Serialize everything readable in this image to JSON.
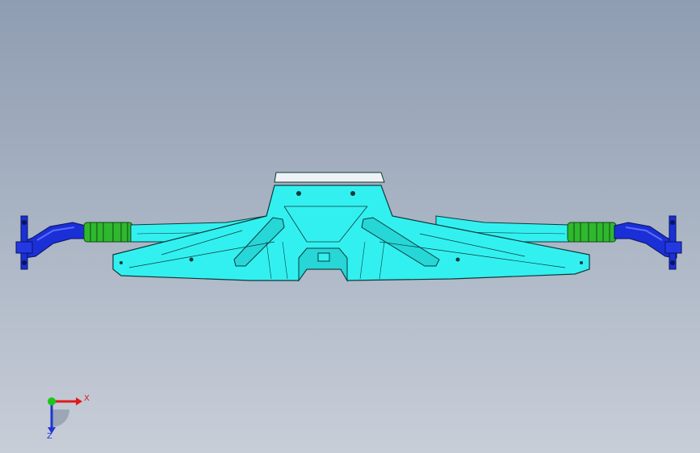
{
  "viewport": {
    "model_color": "#33f0f0",
    "edge_color": "#0d3a3a",
    "link_color": "#1a2fd6",
    "bushing_color": "#2fb82f",
    "top_plate_color": "#eef2f4"
  },
  "triad": {
    "x_label": "X",
    "z_label": "Z",
    "x_color": "#e01919",
    "y_color": "#19c719",
    "z_color": "#2233d6"
  }
}
